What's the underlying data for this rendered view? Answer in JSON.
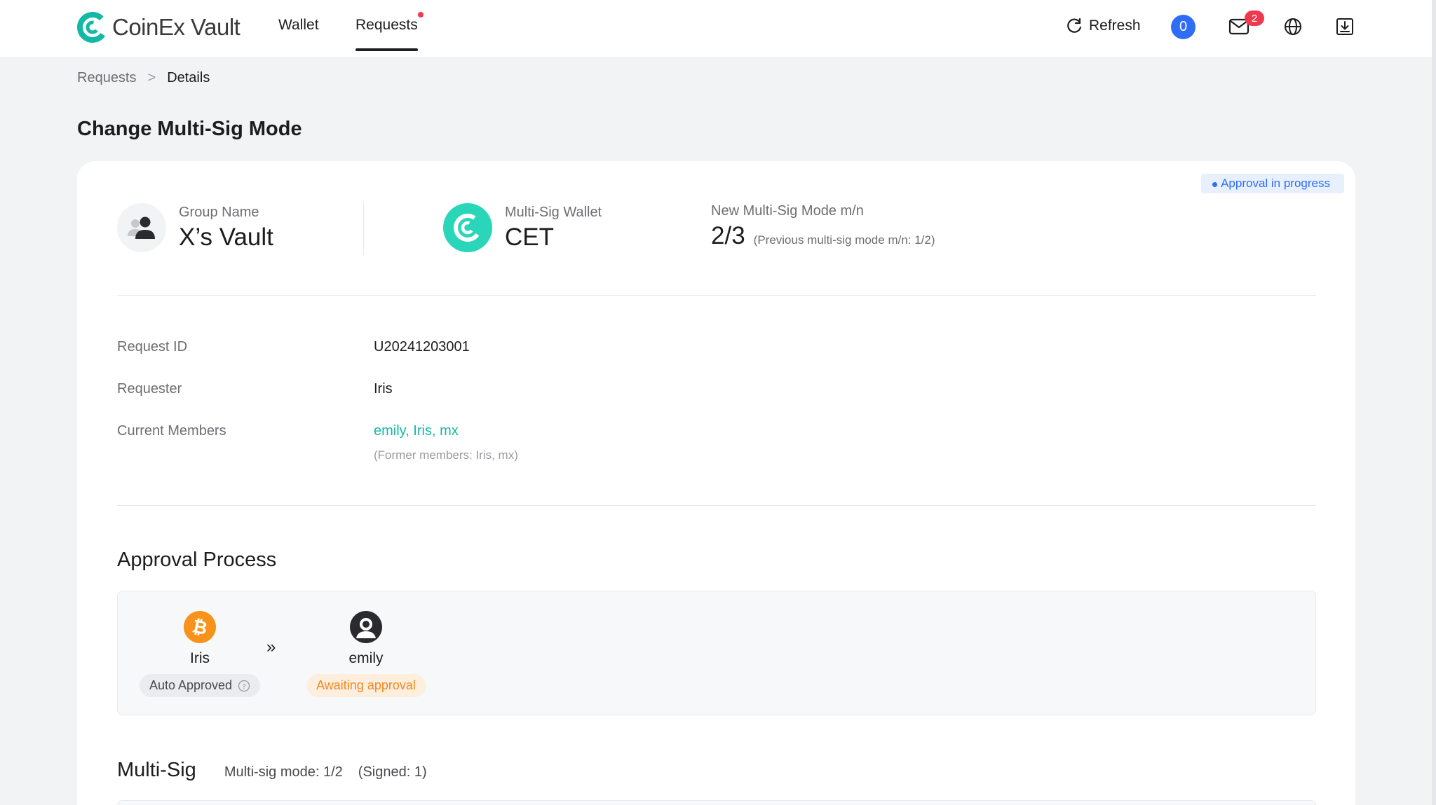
{
  "header": {
    "logo_text": "CoinEx Vault",
    "nav": [
      {
        "label": "Wallet"
      },
      {
        "label": "Requests"
      }
    ],
    "refresh_label": "Refresh",
    "pending_count": "0",
    "mail_badge": "2",
    "accent_color": "#14b8a6",
    "icons": [
      "refresh-icon",
      "mail-icon",
      "globe-icon",
      "download-icon"
    ]
  },
  "breadcrumb": {
    "parent": "Requests",
    "separator": ">",
    "current": "Details"
  },
  "page": {
    "title": "Change Multi-Sig Mode",
    "status": "Approval in progress"
  },
  "summary": {
    "group_label": "Group Name",
    "group_value": "X’s Vault",
    "wallet_label": "Multi-Sig Wallet",
    "wallet_value": "CET",
    "mode_label": "New Multi-Sig Mode m/n",
    "mode_value": "2/3",
    "mode_previous": "(Previous multi-sig mode m/n: 1/2)"
  },
  "details": {
    "request_id_label": "Request ID",
    "request_id_value": "U20241203001",
    "requester_label": "Requester",
    "requester_value": "Iris",
    "members_label": "Current Members",
    "members_value": "emily, Iris, mx",
    "members_former": "(Former members: Iris, mx)"
  },
  "approval": {
    "title": "Approval Process",
    "separator": "»",
    "steps": [
      {
        "name": "Iris",
        "status": "Auto Approved"
      },
      {
        "name": "emily",
        "status": "Awaiting approval"
      }
    ]
  },
  "multisig": {
    "title": "Multi-Sig",
    "mode": "Multi-sig mode: 1/2",
    "signed": "(Signed: 1)"
  }
}
